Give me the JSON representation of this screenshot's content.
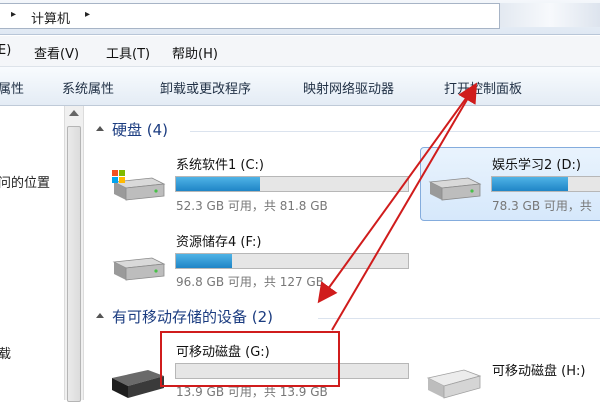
{
  "address": {
    "breadcrumb": "计算机",
    "separator": "▸"
  },
  "menubar": {
    "items": [
      "E)",
      "查看(V)",
      "工具(T)",
      "帮助(H)"
    ]
  },
  "commandbar": {
    "items": [
      "属性",
      "系统属性",
      "卸载或更改程序",
      "映射网络驱动器",
      "打开控制面板"
    ]
  },
  "nav": {
    "items": [
      "问的位置",
      "载"
    ]
  },
  "groups": {
    "hard_disks": {
      "title": "硬盘 (4)"
    },
    "removable": {
      "title": "有可移动存储的设备 (2)"
    }
  },
  "drives": [
    {
      "label": "系统软件1 (C:)",
      "free": "52.3 GB 可用，共 81.8 GB",
      "used_fraction": 0.36
    },
    {
      "label": "娱乐学习2 (D:)",
      "free": "78.3 GB 可用，共",
      "used_fraction": 0.68
    },
    {
      "label": "资源储存4 (F:)",
      "free": "96.8 GB 可用，共 127 GB",
      "used_fraction": 0.24
    },
    {
      "label": "可移动磁盘 (G:)",
      "free": "13.9 GB 可用，共 13.9 GB",
      "used_fraction": 0.0
    },
    {
      "label": "可移动磁盘 (H:)"
    }
  ],
  "colors": {
    "annotation": "#d01c1c",
    "group_header": "#1b3c80",
    "usage_bar": "#2a95d3"
  }
}
